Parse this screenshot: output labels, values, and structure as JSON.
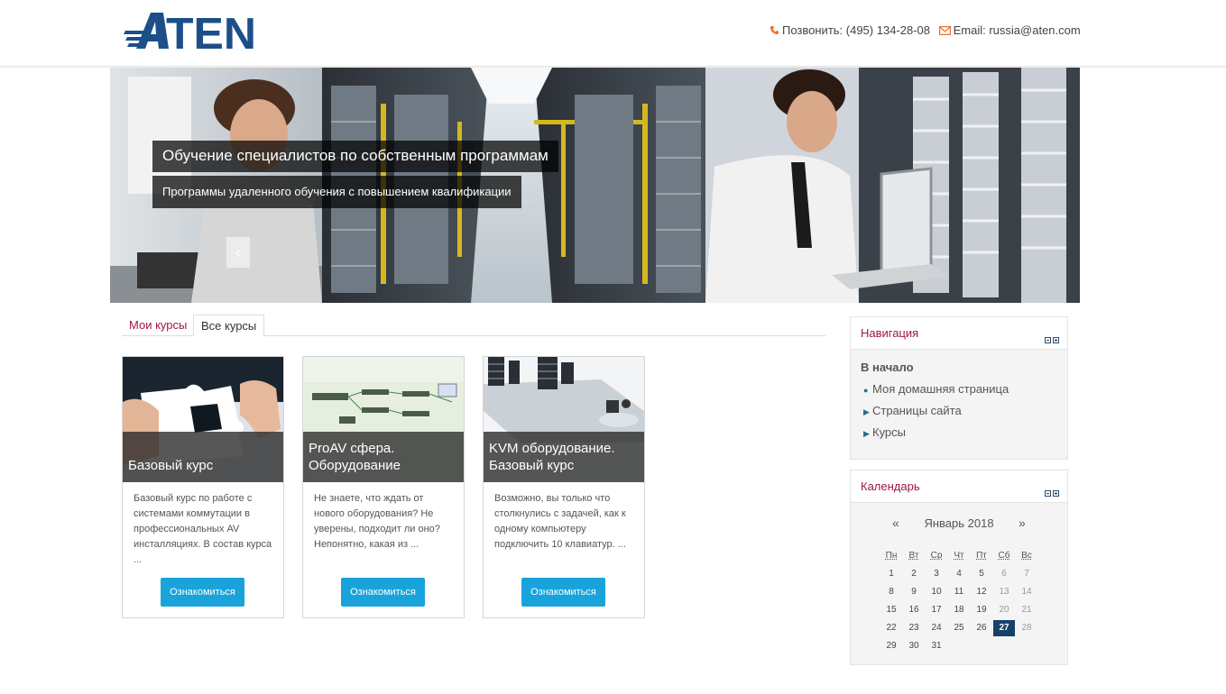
{
  "header": {
    "logo_text": "ATEN",
    "phone_label": "Позвонить: (495) 134-28-08",
    "email_label": "Email: russia@aten.com"
  },
  "slider": {
    "caption_title": "Обучение специалистов по собственным программам",
    "caption_text": "Программы удаленного обучения с повышением квалификации",
    "prev_glyph": "‹",
    "next_glyph": "›"
  },
  "tabs": {
    "my_courses": "Мои курсы",
    "all_courses": "Все курсы"
  },
  "courses": [
    {
      "title": "Базовый курс",
      "description": "Базовый курс по работе с системами коммутации в профессиональных AV инсталляциях. В состав курса ...",
      "button": "Ознакомиться"
    },
    {
      "title": "ProAV сфера. Оборудование",
      "description": "Не знаете, что ждать от нового оборудования? Не уверены, подходит ли оно? Непонятно, какая из ...",
      "button": "Ознакомиться"
    },
    {
      "title": "KVM оборудование. Базовый курс",
      "description": "Возможно, вы только что столкнулись с задачей, как к одному компьютеру подключить 10 клавиатур. ...",
      "button": "Ознакомиться"
    }
  ],
  "navigation": {
    "title": "Навигация",
    "home": "В начало",
    "items": [
      "Моя домашняя страница",
      "Страницы сайта",
      "Курсы"
    ]
  },
  "calendar": {
    "title": "Календарь",
    "month": "Январь 2018",
    "prev": "«",
    "next": "»",
    "weekdays": [
      "Пн",
      "Вт",
      "Ср",
      "Чт",
      "Пт",
      "Сб",
      "Вс"
    ],
    "weeks": [
      [
        "1",
        "2",
        "3",
        "4",
        "5",
        "6",
        "7"
      ],
      [
        "8",
        "9",
        "10",
        "11",
        "12",
        "13",
        "14"
      ],
      [
        "15",
        "16",
        "17",
        "18",
        "19",
        "20",
        "21"
      ],
      [
        "22",
        "23",
        "24",
        "25",
        "26",
        "27",
        "28"
      ],
      [
        "29",
        "30",
        "31",
        "",
        "",
        "",
        ""
      ]
    ],
    "today": "27"
  },
  "colors": {
    "accent": "#a0154b",
    "button": "#1aa3db",
    "logo": "#1c4f8a",
    "today": "#17416a"
  }
}
